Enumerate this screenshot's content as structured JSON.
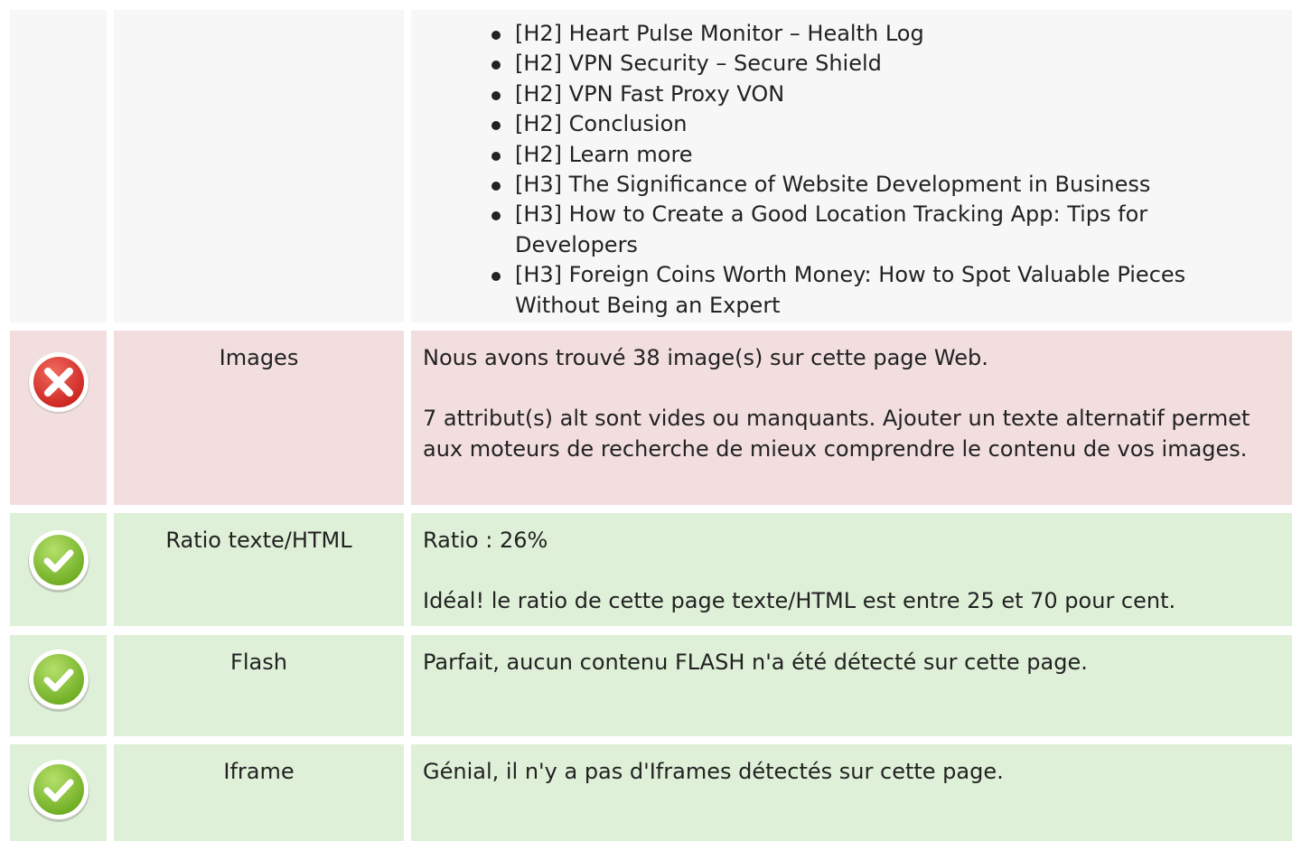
{
  "headings_list": {
    "items": [
      "[H2] Heart Pulse Monitor – Health Log",
      "[H2] VPN Security – Secure Shield",
      "[H2] VPN Fast Proxy VON",
      "[H2] Conclusion",
      "[H2] Learn more",
      "[H3] The Significance of Website Development in Business",
      "[H3] How to Create a Good Location Tracking App: Tips for Developers",
      "[H3] Foreign Coins Worth Money: How to Spot Valuable Pieces Without Being an Expert"
    ]
  },
  "rows": [
    {
      "status": "error",
      "icon": "error-x-icon",
      "label": "Images",
      "paragraphs": [
        "Nous avons trouvé 38 image(s) sur cette page Web.",
        "7 attribut(s) alt sont vides ou manquants. Ajouter un texte alternatif permet aux moteurs de recherche de mieux comprendre le contenu de vos images."
      ]
    },
    {
      "status": "success",
      "icon": "check-icon",
      "label": "Ratio texte/HTML",
      "paragraphs": [
        "Ratio : 26%",
        "Idéal! le ratio de cette page texte/HTML est entre 25 et 70 pour cent."
      ]
    },
    {
      "status": "success",
      "icon": "check-icon",
      "label": "Flash",
      "paragraphs": [
        "Parfait, aucun contenu FLASH n'a été détecté sur cette page."
      ]
    },
    {
      "status": "success",
      "icon": "check-icon",
      "label": "Iframe",
      "paragraphs": [
        "Génial, il n'y a pas d'Iframes détectés sur cette page."
      ]
    }
  ],
  "colors": {
    "neutral_bg": "#f7f7f7",
    "error_bg": "#f2dede",
    "success_bg": "#dff0d8",
    "error_icon": "#d9302c",
    "success_icon": "#8cc63f"
  }
}
